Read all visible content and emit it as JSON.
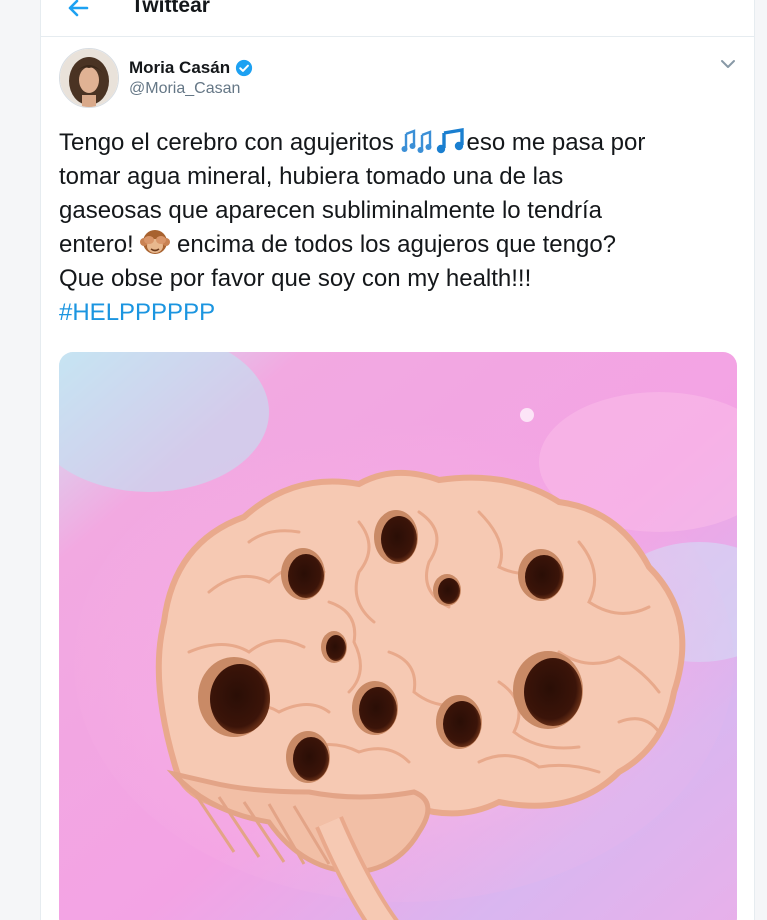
{
  "header": {
    "title": "Twittear",
    "back_icon": "arrow-left-icon"
  },
  "tweet": {
    "author": {
      "name": "Moria Casán",
      "handle": "@Moria_Casan",
      "verified": true
    },
    "text_lines": [
      {
        "before": "Tengo el cerebro con agujeritos ",
        "after": "eso me pasa por"
      },
      "tomar agua mineral, hubiera tomado una de las",
      "gaseosas que aparecen subliminalmente lo tendría",
      {
        "before": "entero! ",
        "after": " encima de todos los agujeros que tengo?"
      },
      "Que obse por favor que soy con my health!!!"
    ],
    "hashtag": "#HELPPPPPP",
    "media_icon": "brain-with-holes-illustration"
  },
  "colors": {
    "accent": "#1b95e0",
    "verified": "#1da1f2",
    "text": "#14171a",
    "muted": "#657786"
  }
}
